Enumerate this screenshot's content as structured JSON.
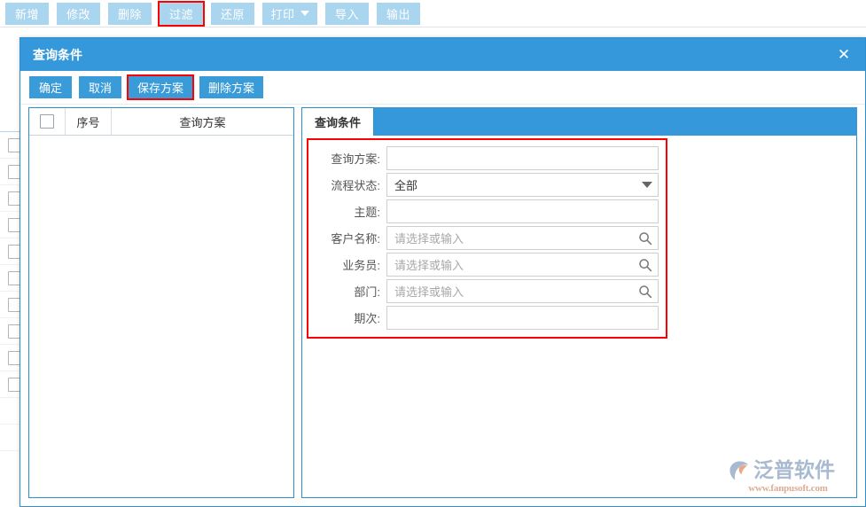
{
  "app": {
    "toolbar": {
      "buttons": [
        {
          "label": "新增",
          "name": "add-button",
          "highlighted": false,
          "dropdown": false
        },
        {
          "label": "修改",
          "name": "edit-button",
          "highlighted": false,
          "dropdown": false
        },
        {
          "label": "删除",
          "name": "delete-button",
          "highlighted": false,
          "dropdown": false
        },
        {
          "label": "过滤",
          "name": "filter-button",
          "highlighted": true,
          "dropdown": false
        },
        {
          "label": "还原",
          "name": "restore-button",
          "highlighted": false,
          "dropdown": false
        },
        {
          "label": "打印",
          "name": "print-button",
          "highlighted": false,
          "dropdown": true
        },
        {
          "label": "导入",
          "name": "import-button",
          "highlighted": false,
          "dropdown": false
        },
        {
          "label": "输出",
          "name": "export-button",
          "highlighted": false,
          "dropdown": false
        }
      ]
    },
    "background_rows": 12
  },
  "dialog": {
    "title": "查询条件",
    "close_icon": "✕",
    "toolbar": [
      {
        "label": "确定",
        "name": "confirm-button",
        "highlighted": false
      },
      {
        "label": "取消",
        "name": "cancel-button",
        "highlighted": false
      },
      {
        "label": "保存方案",
        "name": "save-scheme-button",
        "highlighted": true
      },
      {
        "label": "删除方案",
        "name": "delete-scheme-button",
        "highlighted": false
      }
    ],
    "scheme_table": {
      "headers": {
        "select_all": "",
        "seq": "序号",
        "scheme": "查询方案"
      },
      "rows": []
    },
    "tabs": [
      {
        "label": "查询条件",
        "active": true
      }
    ],
    "form": {
      "fields": [
        {
          "label": "查询方案:",
          "name": "query-scheme-field",
          "value": "",
          "placeholder": "",
          "control": "text"
        },
        {
          "label": "流程状态:",
          "name": "process-status-field",
          "value": "全部",
          "placeholder": "",
          "control": "select"
        },
        {
          "label": "主题:",
          "name": "subject-field",
          "value": "",
          "placeholder": "",
          "control": "text"
        },
        {
          "label": "客户名称:",
          "name": "customer-name-field",
          "value": "",
          "placeholder": "请选择或输入",
          "control": "lookup"
        },
        {
          "label": "业务员:",
          "name": "salesperson-field",
          "value": "",
          "placeholder": "请选择或输入",
          "control": "lookup"
        },
        {
          "label": "部门:",
          "name": "department-field",
          "value": "",
          "placeholder": "请选择或输入",
          "control": "lookup"
        },
        {
          "label": "期次:",
          "name": "period-field",
          "value": "",
          "placeholder": "",
          "control": "text"
        }
      ]
    }
  },
  "watermark": {
    "brand": "泛普软件",
    "url": "www.fanpusoft.com"
  },
  "colors": {
    "accent_blue": "#3498da",
    "button_blue": "#3a9bd9",
    "toolbar_blue": "#a9d5ef",
    "highlight_red": "#ff0000",
    "panel_border": "#2e8fce"
  }
}
